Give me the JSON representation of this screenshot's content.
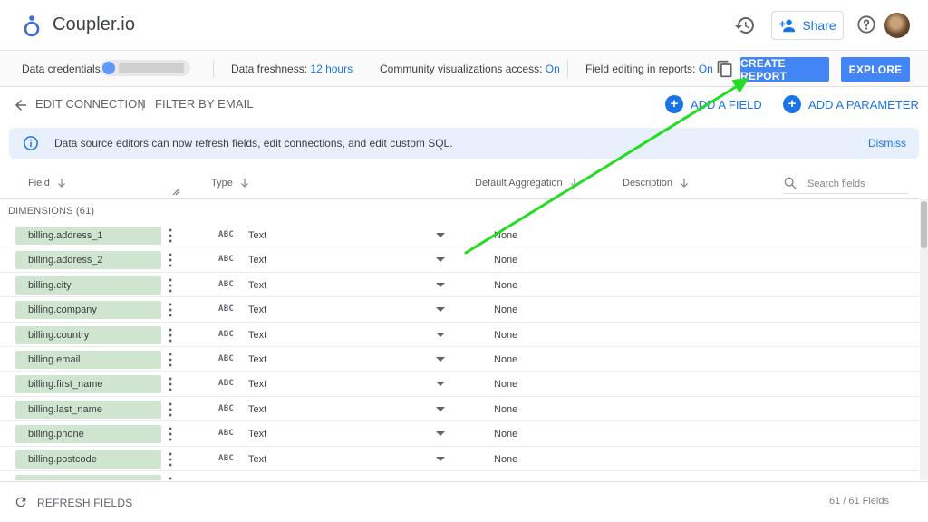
{
  "app": {
    "title": "Coupler.io"
  },
  "header": {
    "share_label": "Share"
  },
  "infobar": {
    "credentials_label": "Data credentials:",
    "freshness_label": "Data freshness:",
    "freshness_value": "12 hours",
    "community_label": "Community visualizations access:",
    "community_value": "On",
    "field_editing_label": "Field editing in reports:",
    "field_editing_value": "On",
    "create_report_label": "CREATE REPORT",
    "explore_label": "EXPLORE"
  },
  "nav": {
    "edit_connection": "EDIT CONNECTION",
    "separator": "|",
    "filter_by_email": "FILTER BY EMAIL",
    "add_field": "ADD A FIELD",
    "add_parameter": "ADD A PARAMETER"
  },
  "banner": {
    "text": "Data source editors can now refresh fields, edit connections, and edit custom SQL.",
    "dismiss": "Dismiss"
  },
  "table": {
    "headers": {
      "field": "Field",
      "type": "Type",
      "default_aggregation": "Default Aggregation",
      "description": "Description"
    },
    "search_placeholder": "Search fields",
    "section_label": "DIMENSIONS (61)",
    "rows": [
      {
        "field": "billing.address_1",
        "type_icon": "ABC",
        "type": "Text",
        "aggregation": "None"
      },
      {
        "field": "billing.address_2",
        "type_icon": "ABC",
        "type": "Text",
        "aggregation": "None"
      },
      {
        "field": "billing.city",
        "type_icon": "ABC",
        "type": "Text",
        "aggregation": "None"
      },
      {
        "field": "billing.company",
        "type_icon": "ABC",
        "type": "Text",
        "aggregation": "None"
      },
      {
        "field": "billing.country",
        "type_icon": "ABC",
        "type": "Text",
        "aggregation": "None"
      },
      {
        "field": "billing.email",
        "type_icon": "ABC",
        "type": "Text",
        "aggregation": "None"
      },
      {
        "field": "billing.first_name",
        "type_icon": "ABC",
        "type": "Text",
        "aggregation": "None"
      },
      {
        "field": "billing.last_name",
        "type_icon": "ABC",
        "type": "Text",
        "aggregation": "None"
      },
      {
        "field": "billing.phone",
        "type_icon": "ABC",
        "type": "Text",
        "aggregation": "None"
      },
      {
        "field": "billing.postcode",
        "type_icon": "ABC",
        "type": "Text",
        "aggregation": "None"
      },
      {
        "field": "",
        "type_icon": "",
        "type": "",
        "aggregation": ""
      }
    ]
  },
  "footer": {
    "refresh_label": "REFRESH FIELDS",
    "count": "61 / 61 Fields"
  },
  "colors": {
    "accent": "#1a73e8",
    "primary_button": "#4285f4",
    "field_chip": "#cfe5cf",
    "annotation_arrow": "#22dd22"
  },
  "icons": [
    "coupler-logo-icon",
    "history-icon",
    "add-person-icon",
    "help-icon",
    "copy-icon",
    "back-arrow-icon",
    "info-icon",
    "search-icon",
    "sort-arrow-icon",
    "kebab-icon",
    "dropdown-icon",
    "refresh-icon"
  ]
}
